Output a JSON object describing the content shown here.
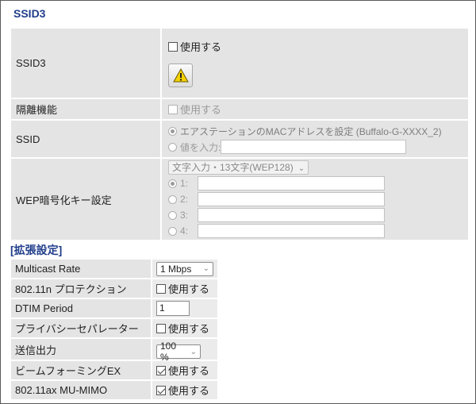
{
  "section_title": "SSID3",
  "rows": {
    "ssid3": {
      "label": "SSID3",
      "use_label": "使用する"
    },
    "isolation": {
      "label": "隔離機能",
      "use_label": "使用する"
    },
    "ssid": {
      "label": "SSID",
      "option1": "エアステーションのMACアドレスを設定 (Buffalo-G-XXXX_2)",
      "option2": "値を入力:"
    },
    "wep": {
      "label": "WEP暗号化キー設定",
      "mode_select": "文字入力・13文字(WEP128)",
      "keys": [
        "1:",
        "2:",
        "3:",
        "4:"
      ]
    }
  },
  "ext_title": "[拡張設定]",
  "ext": {
    "multicast": {
      "label": "Multicast Rate",
      "value": "1 Mbps"
    },
    "protection": {
      "label": "802.11n プロテクション",
      "use_label": "使用する"
    },
    "dtim": {
      "label": "DTIM Period",
      "value": "1"
    },
    "privacy": {
      "label": "プライバシーセパレーター",
      "use_label": "使用する"
    },
    "tx_power": {
      "label": "送信出力",
      "value": "100 %"
    },
    "beamforming": {
      "label": "ビームフォーミングEX",
      "use_label": "使用する"
    },
    "mumimo": {
      "label": "802.11ax MU-MIMO",
      "use_label": "使用する"
    }
  },
  "colors": {
    "accent": "#1f3d8a",
    "cell_bg": "#e4e4e4"
  },
  "icons": {
    "warning": "warning-icon",
    "chevron": "chevron-down-icon"
  }
}
